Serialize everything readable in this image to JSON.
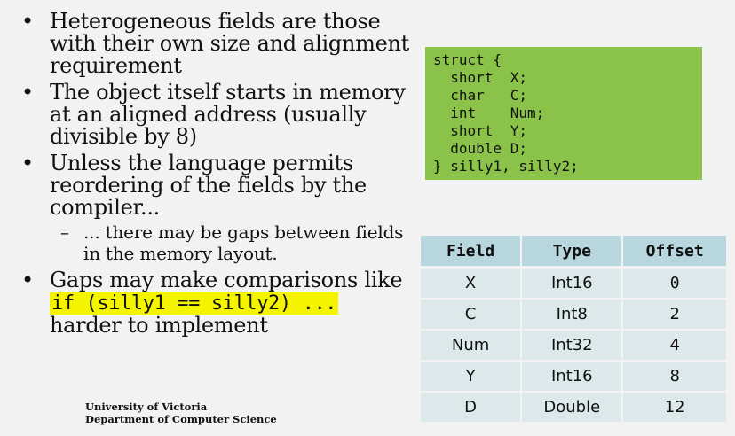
{
  "bullets": [
    {
      "text": "Heterogeneous fields are those with their own size and alignment requirement"
    },
    {
      "text": "The object itself starts in memory at an aligned address (usually divisible by 8)"
    },
    {
      "text": "Unless the language permits reordering of the fields by the compiler..."
    }
  ],
  "sub_bullet": "... there may be gaps between fields in the memory layout.",
  "last_bullet": {
    "text_before": "Gaps may make comparisons like",
    "code": "if (silly1 == silly2) ...",
    "text_after": "harder to implement"
  },
  "code_block": "struct {\n  short  X;\n  char   C;\n  int    Num;\n  short  Y;\n  double D;\n} silly1, silly2;",
  "table": {
    "headers": [
      "Field",
      "Type",
      "Offset"
    ],
    "rows": [
      [
        "X",
        "Int16",
        "0"
      ],
      [
        "C",
        "Int8",
        "2"
      ],
      [
        "Num",
        "Int32",
        "4"
      ],
      [
        "Y",
        "Int16",
        "8"
      ],
      [
        "D",
        "Double",
        "12"
      ]
    ]
  },
  "footer": {
    "line1": "University of Victoria",
    "line2": "Department of Computer Science"
  },
  "colors": {
    "code_block_bg": "#8bc34a",
    "highlight": "#f5f400",
    "table_header": "#b7d6dd",
    "table_cell": "#dce8ea"
  }
}
